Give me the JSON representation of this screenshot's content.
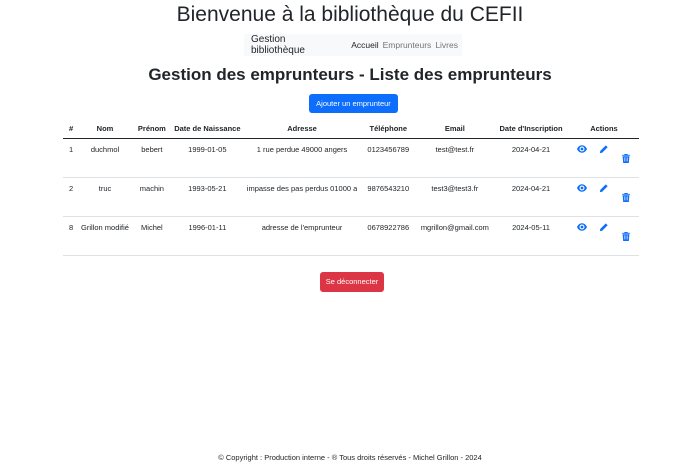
{
  "site": {
    "title": "Bienvenue à la bibliothèque du CEFII"
  },
  "navbar": {
    "brand": "Gestion bibliothèque",
    "links": [
      "Accueil",
      "Emprunteurs",
      "Livres"
    ]
  },
  "page": {
    "title": "Gestion des emprunteurs - Liste des emprunteurs"
  },
  "buttons": {
    "add": "Ajouter un emprunteur",
    "logout": "Se déconnecter"
  },
  "table": {
    "headers": [
      "#",
      "Nom",
      "Prénom",
      "Date de Naissance",
      "Adresse",
      "Téléphone",
      "Email",
      "Date d'Inscription",
      "Actions"
    ],
    "rows": [
      {
        "id": "1",
        "nom": "duchmol",
        "prenom": "bebert",
        "naissance": "1999-01-05",
        "adresse": "1 rue perdue 49000 angers",
        "telephone": "0123456789",
        "email": "test@test.fr",
        "inscription": "2024-04-21"
      },
      {
        "id": "2",
        "nom": "truc",
        "prenom": "machin",
        "naissance": "1993-05-21",
        "adresse": "impasse des pas perdus 01000 a",
        "telephone": "9876543210",
        "email": "test3@test3.fr",
        "inscription": "2024-04-21"
      },
      {
        "id": "8",
        "nom": "Grillon modifié",
        "prenom": "Michel",
        "naissance": "1996-01-11",
        "adresse": "adresse de l'emprunteur",
        "telephone": "0678922786",
        "email": "mgrillon@gmail.com",
        "inscription": "2024-05-11"
      }
    ]
  },
  "icons": {
    "view": "eye-icon",
    "edit": "pencil-icon",
    "delete": "trash-icon"
  },
  "colors": {
    "primary": "#0d6efd",
    "danger": "#dc3545",
    "icon": "#0d6efd"
  },
  "footer": {
    "text": "© Copyright : Production interne - ® Tous droits réservés - Michel Grillon - 2024"
  }
}
